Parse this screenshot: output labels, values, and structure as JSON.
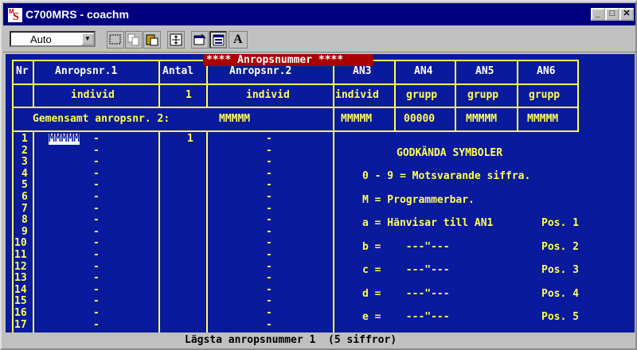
{
  "window": {
    "title": "C700MRS - coachm",
    "minimize": "_",
    "maximize": "□",
    "close": "✕"
  },
  "toolbar": {
    "font_select_value": "Auto",
    "font_select_arrow": "▼",
    "text_button": "A"
  },
  "terminal": {
    "headers": {
      "nr": "Nr",
      "anropsnr1": "Anropsnr.1",
      "antal": "Antal",
      "anropsnr2": "Anropsnr.2",
      "an3": "AN3",
      "an4": "AN4",
      "an5": "AN5",
      "an6": "AN6"
    },
    "banner": "**** Anropsnummer ****",
    "type_row": {
      "anropsnr1": "individ",
      "antal": "1",
      "anropsnr2": "individ",
      "an3": "individ",
      "an4": "grupp",
      "an5": "grupp",
      "an6": "grupp"
    },
    "common": {
      "label": "Gemensamt anropsnr. 2:",
      "value": "MMMMM",
      "an3": "MMMMM",
      "an4": "00000",
      "an5": "MMMMM",
      "an6": "MMMMM"
    },
    "rows": [
      {
        "nr": "1",
        "anr1": "MMMMM",
        "dash1": "-",
        "antal": "1",
        "dash2": "-"
      },
      {
        "nr": "2",
        "anr1": "",
        "dash1": "-",
        "antal": "",
        "dash2": "-"
      },
      {
        "nr": "3",
        "anr1": "",
        "dash1": "-",
        "antal": "",
        "dash2": "-"
      },
      {
        "nr": "4",
        "anr1": "",
        "dash1": "-",
        "antal": "",
        "dash2": "-"
      },
      {
        "nr": "5",
        "anr1": "",
        "dash1": "-",
        "antal": "",
        "dash2": "-"
      },
      {
        "nr": "6",
        "anr1": "",
        "dash1": "-",
        "antal": "",
        "dash2": "-"
      },
      {
        "nr": "7",
        "anr1": "",
        "dash1": "-",
        "antal": "",
        "dash2": "-"
      },
      {
        "nr": "8",
        "anr1": "",
        "dash1": "-",
        "antal": "",
        "dash2": "-"
      },
      {
        "nr": "9",
        "anr1": "",
        "dash1": "-",
        "antal": "",
        "dash2": "-"
      },
      {
        "nr": "10",
        "anr1": "",
        "dash1": "-",
        "antal": "",
        "dash2": "-"
      },
      {
        "nr": "11",
        "anr1": "",
        "dash1": "-",
        "antal": "",
        "dash2": "-"
      },
      {
        "nr": "12",
        "anr1": "",
        "dash1": "-",
        "antal": "",
        "dash2": "-"
      },
      {
        "nr": "13",
        "anr1": "",
        "dash1": "-",
        "antal": "",
        "dash2": "-"
      },
      {
        "nr": "14",
        "anr1": "",
        "dash1": "-",
        "antal": "",
        "dash2": "-"
      },
      {
        "nr": "15",
        "anr1": "",
        "dash1": "-",
        "antal": "",
        "dash2": "-"
      },
      {
        "nr": "16",
        "anr1": "",
        "dash1": "-",
        "antal": "",
        "dash2": "-"
      },
      {
        "nr": "17",
        "anr1": "",
        "dash1": "-",
        "antal": "",
        "dash2": "-"
      }
    ],
    "symbols": {
      "title": "GODKÄNDA SYMBOLER",
      "lines": [
        {
          "left": "0 - 9 = Motsvarande siffra.",
          "right": ""
        },
        {
          "left": "M = Programmerbar.",
          "right": ""
        },
        {
          "left": "a = Hänvisar till AN1",
          "right": "Pos. 1"
        },
        {
          "left": "b =    ---\"---",
          "right": "Pos. 2"
        },
        {
          "left": "c =    ---\"---",
          "right": "Pos. 3"
        },
        {
          "left": "d =    ---\"---",
          "right": "Pos. 4"
        },
        {
          "left": "e =    ---\"---",
          "right": "Pos. 5"
        }
      ]
    },
    "status": "Lägsta anropsnummer 1  (5 siffror)"
  },
  "colors": {
    "terminal_bg": "#0a1a9c",
    "terminal_fg": "#ffff55",
    "banner_bg": "#aa0000",
    "titlebar": "#000080"
  }
}
